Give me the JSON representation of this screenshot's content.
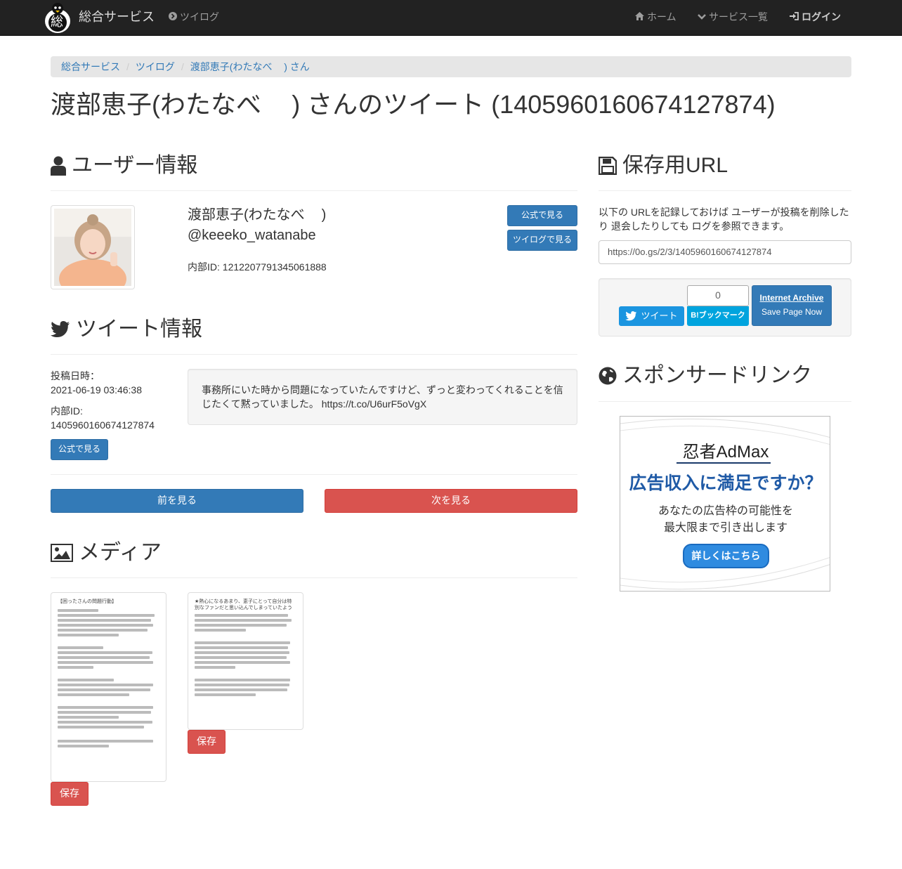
{
  "nav": {
    "brand": "総合サービス",
    "brand_logo_char": "総",
    "tweet_log": "ツイログ",
    "home": "ホーム",
    "services": "サービス一覧",
    "login": "ログイン"
  },
  "breadcrumb": [
    "総合サービス",
    "ツイログ",
    "渡部恵子(わたなべ  ) さん"
  ],
  "page_title": "渡部恵子(わたなべ  ) さんのツイート (1405960160674127874)",
  "user_section": {
    "title": "ユーザー情報",
    "display_name": "渡部恵子(わたなべ  )",
    "handle": "@keeeko_watanabe",
    "internal_id": "内部ID: 1212207791345061888",
    "official_button": "公式で見る",
    "tweetlog_button": "ツイログで見る"
  },
  "tweet_section": {
    "title": "ツイート情報",
    "posted_label": "投稿日時：",
    "posted_value": "2021-06-19 03:46:38",
    "id_label": "内部ID:",
    "id_value": "1405960160674127874",
    "official_button": "公式で見る",
    "text": "事務所にいた時から問題になっていたんですけど、ずっと変わってくれることを信じたくて黙っていました。 https://t.co/U6urF5oVgX"
  },
  "pager": {
    "prev": "前を見る",
    "next": "次を見る"
  },
  "media_section": {
    "title": "メディア",
    "save_label": "保存",
    "image1_heading": "【困ったさんの問題行動】",
    "image2_heading": "★熱心になるあまり、恵子にとって自分は特別なファンだと思い込んでしまっていたように感じました。"
  },
  "save_url": {
    "title": "保存用URL",
    "description": "以下の URLを記録しておけば ユーザーが投稿を削除したり 退会したりしても ログを参照できます。",
    "url": "https://0o.gs/2/3/1405960160674127874",
    "tweet_button": "ツイート",
    "bookmark_count": "0",
    "bookmark_label": "B!ブックマーク",
    "archive_title": "Internet Archive",
    "archive_action": "Save Page Now"
  },
  "sponsor": {
    "title": "スポンサードリンク",
    "ad_brand": "忍者AdMax",
    "ad_headline": "広告収入に満足ですか？",
    "ad_line1": "あなたの広告枠の可能性を",
    "ad_line2": "最大限まで引き出します",
    "ad_cta": "詳しくはこちら"
  }
}
